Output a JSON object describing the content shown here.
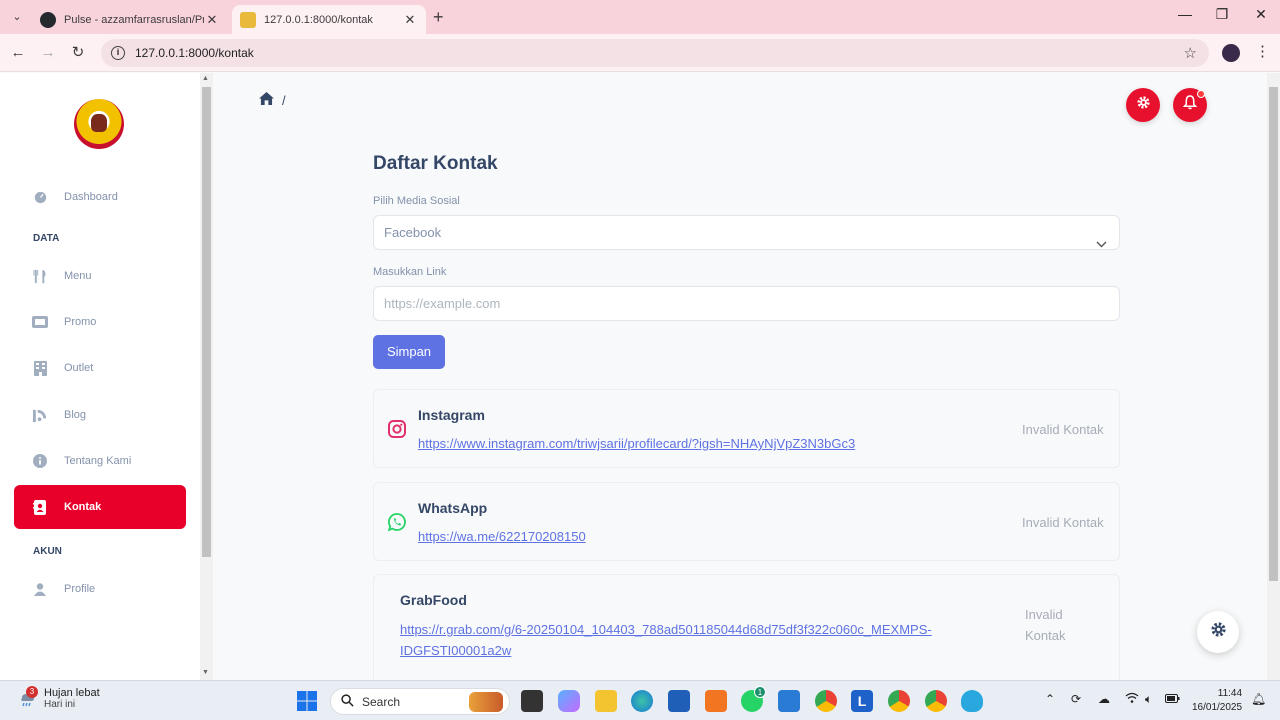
{
  "browser": {
    "tabs": [
      {
        "title": "Pulse - azzamfarrasruslan/Proje",
        "active": false
      },
      {
        "title": "127.0.0.1:8000/kontak",
        "active": true
      }
    ],
    "url": "127.0.0.1:8000/kontak"
  },
  "sidebar": {
    "items": [
      {
        "label": "Dashboard",
        "icon": "dashboard-icon"
      },
      {
        "label": "Menu",
        "icon": "utensils-icon"
      },
      {
        "label": "Promo",
        "icon": "ticket-icon"
      },
      {
        "label": "Outlet",
        "icon": "building-icon"
      },
      {
        "label": "Blog",
        "icon": "blog-icon"
      },
      {
        "label": "Tentang Kami",
        "icon": "info-icon"
      },
      {
        "label": "Kontak",
        "icon": "contact-book-icon",
        "active": true
      },
      {
        "label": "Profile",
        "icon": "user-icon"
      }
    ],
    "sections": {
      "data": "DATA",
      "akun": "AKUN"
    }
  },
  "breadcrumb": {
    "separator": "/"
  },
  "main": {
    "title": "Daftar Kontak",
    "select_label": "Pilih Media Sosial",
    "select_value": "Facebook",
    "link_label": "Masukkan Link",
    "link_placeholder": "https://example.com",
    "save_label": "Simpan"
  },
  "contacts": [
    {
      "name": "Instagram",
      "link": "https://www.instagram.com/triwjsarii/profilecard/?igsh=NHAyNjVpZ3N3bGc3",
      "status": "Invalid Kontak",
      "icon": "instagram-icon"
    },
    {
      "name": "WhatsApp",
      "link": "https://wa.me/622170208150",
      "status": "Invalid Kontak",
      "icon": "whatsapp-icon"
    },
    {
      "name": "GrabFood",
      "link_line1": "https://r.grab.com/g/6-20250104_104403_788ad501185044d68d75df3f322c060c_MEXMPS-",
      "link_line2": "IDGFSTI00001a2w",
      "status_line1": "Invalid",
      "status_line2": "Kontak"
    }
  ],
  "colors": {
    "accent": "#e8002a",
    "primary": "#5e72e4",
    "text": "#344767",
    "muted": "#8392ab"
  },
  "taskbar": {
    "weather_title": "Hujan lebat",
    "weather_sub": "Hari ini",
    "weather_badge": "3",
    "search": "Search",
    "whatsapp_badge": "1",
    "time": "11:44",
    "date": "16/01/2025"
  }
}
